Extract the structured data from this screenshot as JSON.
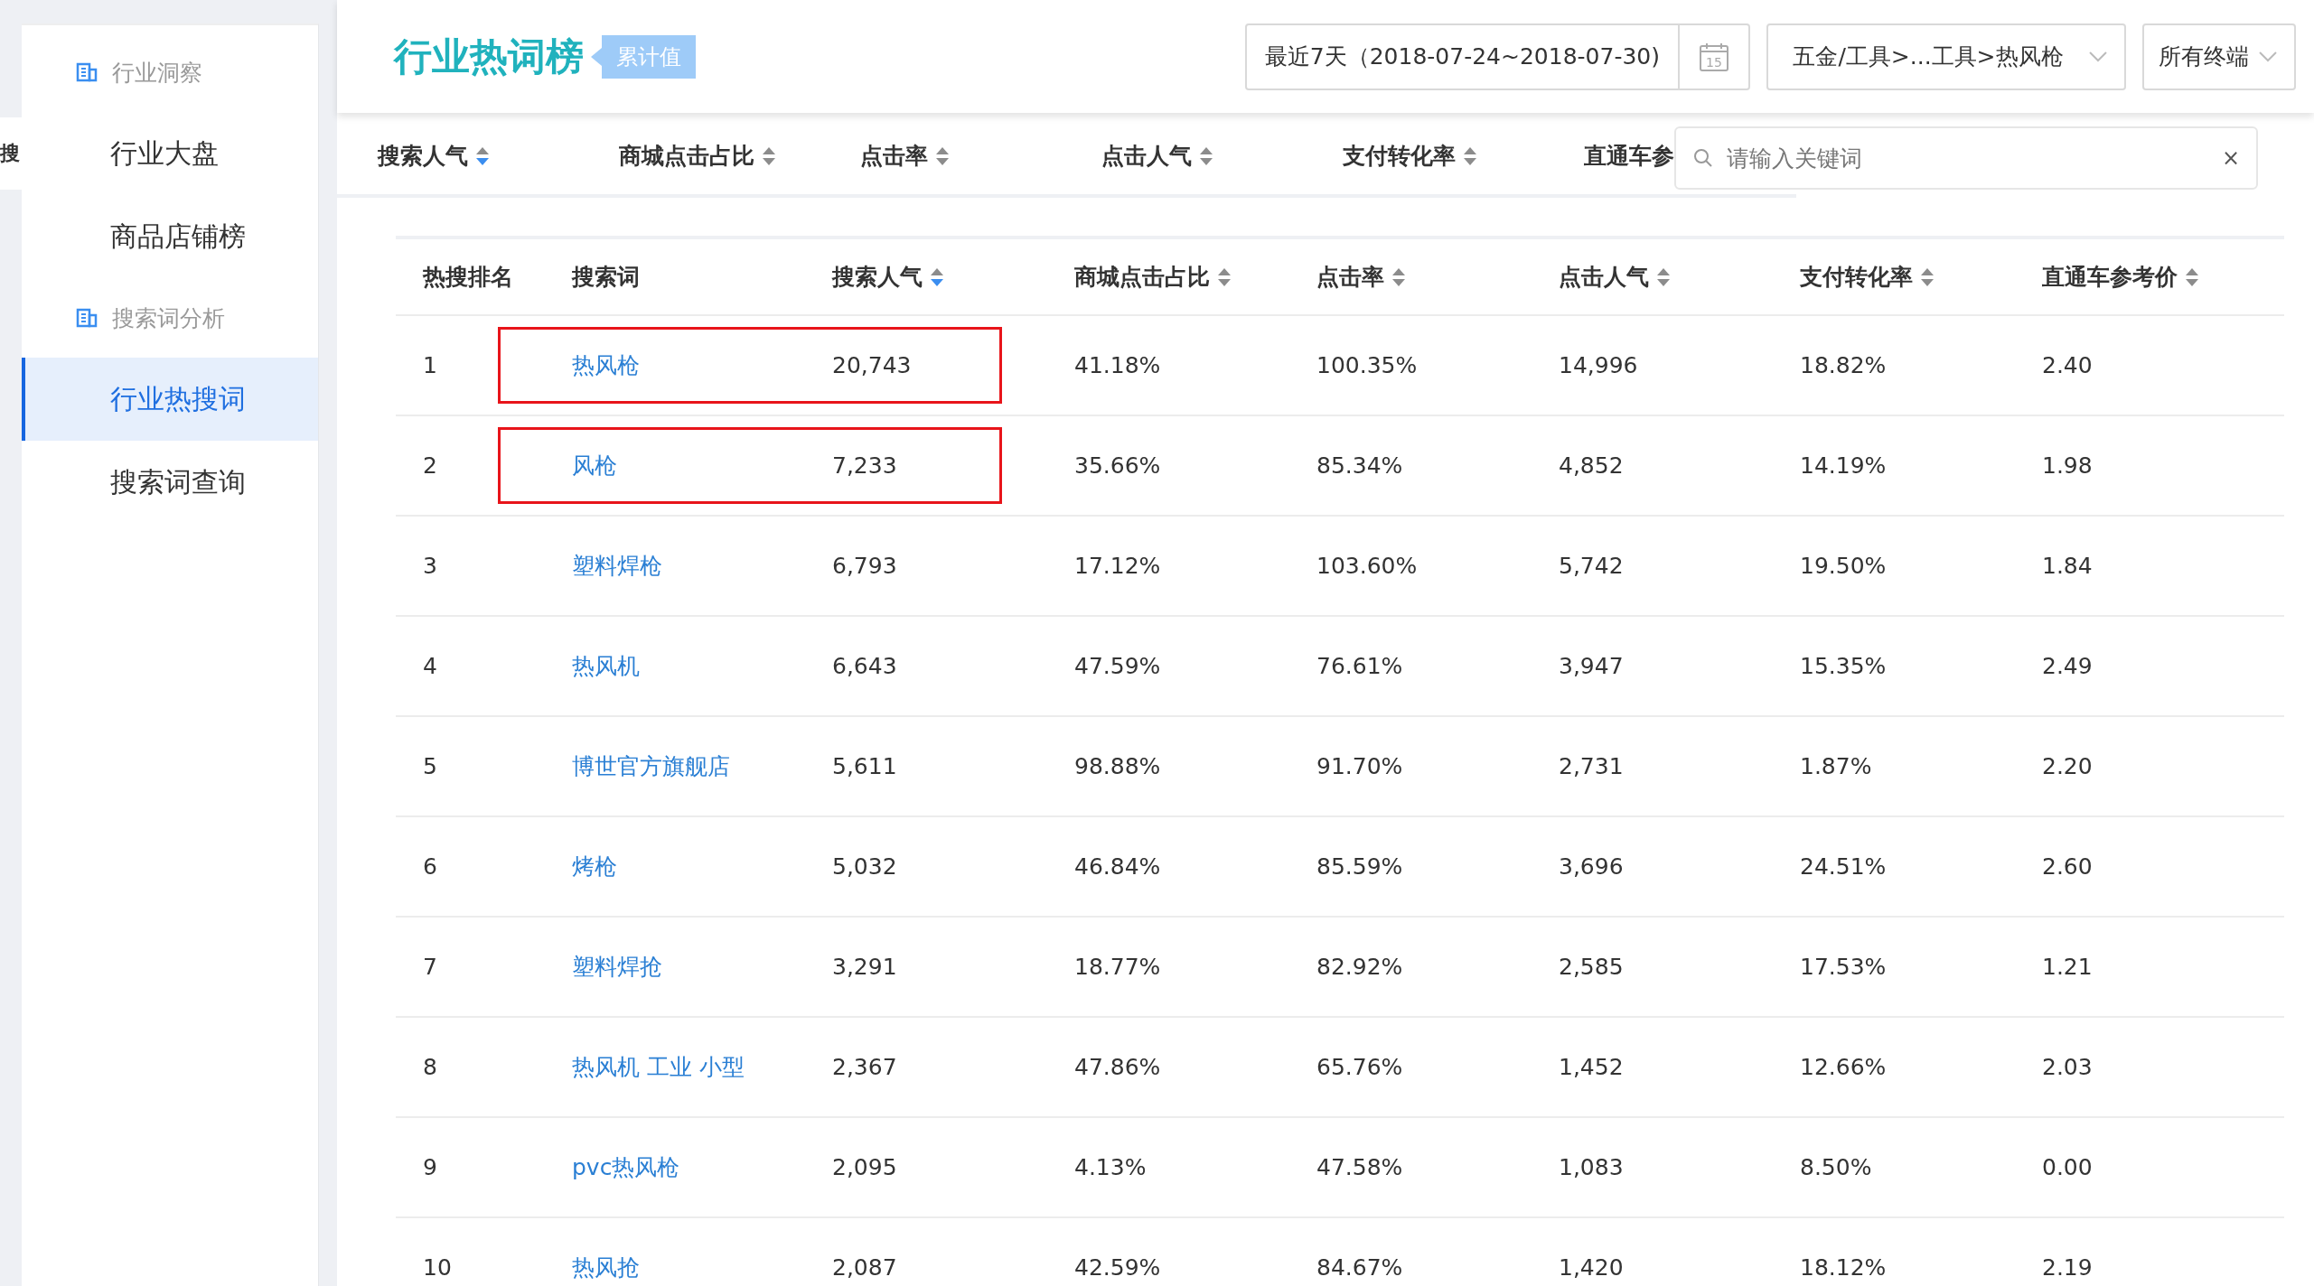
{
  "edge_tab": {
    "label": "搜"
  },
  "sidebar": {
    "items": [
      {
        "kind": "section",
        "label": "行业洞察"
      },
      {
        "kind": "link",
        "label": "行业大盘",
        "selected": false
      },
      {
        "kind": "link",
        "label": "商品店铺榜",
        "selected": false
      },
      {
        "kind": "section",
        "label": "搜索词分析"
      },
      {
        "kind": "link",
        "label": "行业热搜词",
        "selected": true
      },
      {
        "kind": "link",
        "label": "搜索词查询",
        "selected": false
      }
    ]
  },
  "header": {
    "title": "行业热词榜",
    "badge": "累计值",
    "date_range": "最近7天（2018-07-24~2018-07-30)",
    "calendar_day": "15",
    "category": "五金/工具>...工具>热风枪",
    "terminal": "所有终端"
  },
  "sort_bar": [
    {
      "label": "搜索人气",
      "sorted": true
    },
    {
      "label": "商城点击占比",
      "sorted": false
    },
    {
      "label": "点击率",
      "sorted": false
    },
    {
      "label": "点击人气",
      "sorted": false
    },
    {
      "label": "支付转化率",
      "sorted": false
    },
    {
      "label": "直通车参"
    }
  ],
  "search": {
    "placeholder": "请输入关键词",
    "clear": "×"
  },
  "table": {
    "columns": [
      {
        "label": "热搜排名"
      },
      {
        "label": "搜索词"
      },
      {
        "label": "搜索人气",
        "sorted": true
      },
      {
        "label": "商城点击占比",
        "sorted": false
      },
      {
        "label": "点击率",
        "sorted": false
      },
      {
        "label": "点击人气",
        "sorted": false
      },
      {
        "label": "支付转化率",
        "sorted": false
      },
      {
        "label": "直通车参考价",
        "sorted": false
      }
    ],
    "rows": [
      {
        "rank": "1",
        "keyword": "热风枪",
        "values": [
          "20,743",
          "41.18%",
          "100.35%",
          "14,996",
          "18.82%",
          "2.40"
        ],
        "highlighted": true
      },
      {
        "rank": "2",
        "keyword": "风枪",
        "values": [
          "7,233",
          "35.66%",
          "85.34%",
          "4,852",
          "14.19%",
          "1.98"
        ],
        "highlighted": true
      },
      {
        "rank": "3",
        "keyword": "塑料焊枪",
        "values": [
          "6,793",
          "17.12%",
          "103.60%",
          "5,742",
          "19.50%",
          "1.84"
        ],
        "highlighted": false
      },
      {
        "rank": "4",
        "keyword": "热风机",
        "values": [
          "6,643",
          "47.59%",
          "76.61%",
          "3,947",
          "15.35%",
          "2.49"
        ],
        "highlighted": false
      },
      {
        "rank": "5",
        "keyword": "博世官方旗舰店",
        "values": [
          "5,611",
          "98.88%",
          "91.70%",
          "2,731",
          "1.87%",
          "2.20"
        ],
        "highlighted": false
      },
      {
        "rank": "6",
        "keyword": "烤枪",
        "values": [
          "5,032",
          "46.84%",
          "85.59%",
          "3,696",
          "24.51%",
          "2.60"
        ],
        "highlighted": false
      },
      {
        "rank": "7",
        "keyword": "塑料焊抢",
        "values": [
          "3,291",
          "18.77%",
          "82.92%",
          "2,585",
          "17.53%",
          "1.21"
        ],
        "highlighted": false
      },
      {
        "rank": "8",
        "keyword": "热风机 工业 小型",
        "values": [
          "2,367",
          "47.86%",
          "65.76%",
          "1,452",
          "12.66%",
          "2.03"
        ],
        "highlighted": false
      },
      {
        "rank": "9",
        "keyword": "pvc热风枪",
        "values": [
          "2,095",
          "4.13%",
          "47.58%",
          "1,083",
          "8.50%",
          "0.00"
        ],
        "highlighted": false
      },
      {
        "rank": "10",
        "keyword": "热风抢",
        "values": [
          "2,087",
          "42.59%",
          "84.67%",
          "1,420",
          "18.12%",
          "2.19"
        ],
        "highlighted": false
      }
    ]
  }
}
